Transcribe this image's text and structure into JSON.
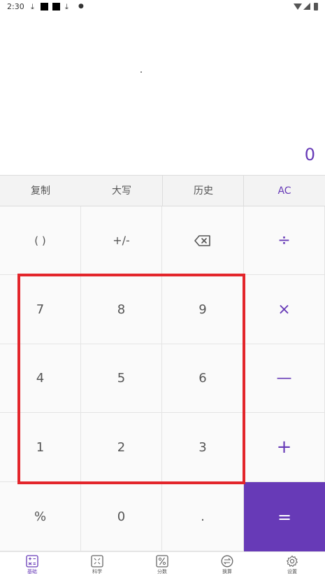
{
  "status_bar": {
    "time": "2:30",
    "left_icons": [
      "download-icon",
      "notification-square-icon",
      "notification-square-icon",
      "download-icon",
      "dot-icon"
    ],
    "right_icons": [
      "wifi-icon",
      "signal-icon",
      "battery-icon"
    ]
  },
  "display": {
    "value": "0"
  },
  "function_row": {
    "copy": "复制",
    "uppercase": "大写",
    "history": "历史",
    "clear": "AC"
  },
  "keypad": {
    "parentheses": "( )",
    "plus_minus": "+∕-",
    "backspace_icon": "backspace-icon",
    "divide": "÷",
    "seven": "7",
    "eight": "8",
    "nine": "9",
    "multiply": "×",
    "four": "4",
    "five": "5",
    "six": "6",
    "minus": "—",
    "one": "1",
    "two": "2",
    "three": "3",
    "plus": "+",
    "percent": "%",
    "zero": "0",
    "decimal": ".",
    "equals": "="
  },
  "bottom_nav": {
    "items": [
      {
        "label": "基础",
        "icon": "basic-calculator-icon",
        "active": true
      },
      {
        "label": "科学",
        "icon": "scientific-calculator-icon",
        "active": false
      },
      {
        "label": "分数",
        "icon": "fraction-icon",
        "active": false
      },
      {
        "label": "换算",
        "icon": "conversion-icon",
        "active": false
      },
      {
        "label": "设置",
        "icon": "gear-icon",
        "active": false
      }
    ]
  },
  "colors": {
    "accent": "#673ab7",
    "highlight": "#e3252b",
    "pad_background": "#fafafa",
    "function_row_background": "#f3f3f3"
  }
}
